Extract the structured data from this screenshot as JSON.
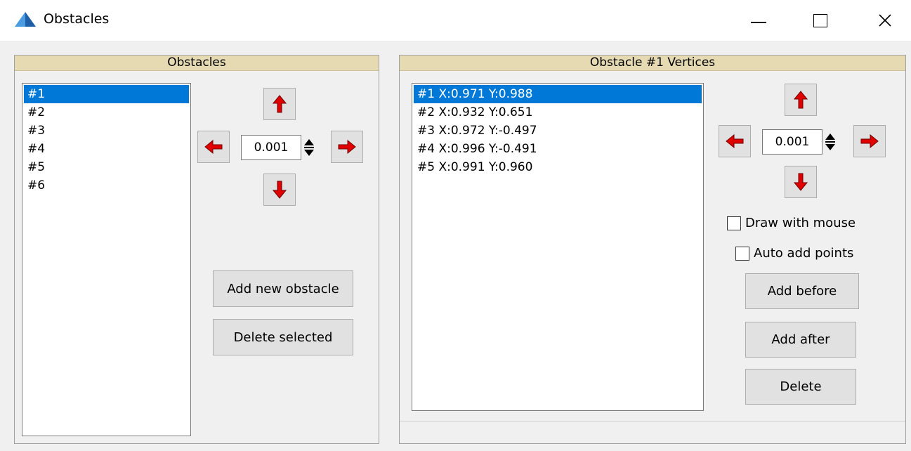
{
  "window": {
    "title": "Obstacles"
  },
  "obstacles_panel": {
    "header": "Obstacles",
    "items": [
      "#1",
      "#2",
      "#3",
      "#4",
      "#5",
      "#6"
    ],
    "selected_index": 0,
    "step_value": "0.001",
    "add_button": "Add new obstacle",
    "delete_button": "Delete selected"
  },
  "vertices_panel": {
    "header": "Obstacle #1 Vertices",
    "items": [
      "#1 X:0.971 Y:0.988",
      "#2 X:0.932 Y:0.651",
      "#3 X:0.972 Y:-0.497",
      "#4 X:0.996 Y:-0.491",
      "#5 X:0.991 Y:0.960"
    ],
    "selected_index": 0,
    "step_value": "0.001",
    "draw_with_mouse_label": "Draw with mouse",
    "draw_with_mouse_checked": false,
    "auto_add_points_label": "Auto add points",
    "auto_add_points_checked": false,
    "add_before_button": "Add before",
    "add_after_button": "Add after",
    "delete_button": "Delete"
  },
  "colors": {
    "header_bg": "#e6dab2",
    "selection": "#0078d7",
    "arrow_red": "#e00000"
  }
}
